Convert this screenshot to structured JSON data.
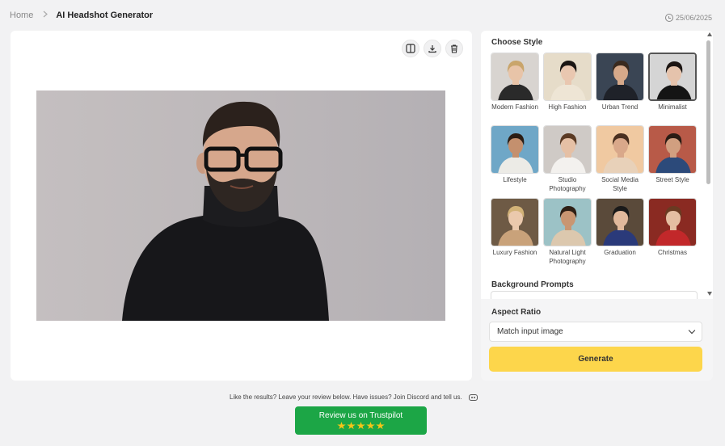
{
  "breadcrumb": {
    "home": "Home",
    "separator": ">",
    "current": "AI Headshot Generator"
  },
  "date": "25/06/2025",
  "toolbar": {
    "icons": [
      "compare-icon",
      "download-icon",
      "trash-icon"
    ]
  },
  "styles": {
    "title": "Choose Style",
    "items": [
      {
        "label": "Modern Fashion",
        "bg": "#d8d4d0",
        "hair": "#c9a56b",
        "skin": "#e8c4a8",
        "clothes": "#2a2a2a",
        "selected": false
      },
      {
        "label": "High Fashion",
        "bg": "#e6dcc9",
        "hair": "#1b1614",
        "skin": "#e9c7b0",
        "clothes": "#eee5d5",
        "selected": false
      },
      {
        "label": "Urban Trend",
        "bg": "#3a4554",
        "hair": "#3a2a1e",
        "skin": "#d6a98a",
        "clothes": "#1f2229",
        "selected": false
      },
      {
        "label": "Minimalist",
        "bg": "#d5d5d5",
        "hair": "#1c1512",
        "skin": "#e5c3ac",
        "clothes": "#141414",
        "selected": true
      },
      {
        "label": "Lifestyle",
        "bg": "#6fa7c7",
        "hair": "#2b1d14",
        "skin": "#c4906e",
        "clothes": "#ecebe6",
        "selected": false
      },
      {
        "label": "Studio Photography",
        "bg": "#cfcac6",
        "hair": "#5a3a24",
        "skin": "#e5c0a5",
        "clothes": "#f3f1ee",
        "selected": false
      },
      {
        "label": "Social Media Style",
        "bg": "#f0c9a1",
        "hair": "#4a3020",
        "skin": "#d9a88a",
        "clothes": "#e8d1b9",
        "selected": false
      },
      {
        "label": "Street Style",
        "bg": "#b85a48",
        "hair": "#2a1c14",
        "skin": "#d19f80",
        "clothes": "#2c4a7a",
        "selected": false
      },
      {
        "label": "Luxury Fashion",
        "bg": "#6e5a45",
        "hair": "#d2b277",
        "skin": "#ebc9ad",
        "clothes": "#c9a27a",
        "selected": false
      },
      {
        "label": "Natural Light Photography",
        "bg": "#9cc2c6",
        "hair": "#2e1f15",
        "skin": "#c99672",
        "clothes": "#dcc8ae",
        "selected": false
      },
      {
        "label": "Graduation",
        "bg": "#5a4a3a",
        "hair": "#1a1a1a",
        "skin": "#e1b99c",
        "clothes": "#2a3a7a",
        "selected": false
      },
      {
        "label": "Christmas",
        "bg": "#8a2a22",
        "hair": "#6a3a22",
        "skin": "#e5bea2",
        "clothes": "#c2282a",
        "selected": false
      }
    ]
  },
  "background_prompts": {
    "title": "Background Prompts"
  },
  "aspect": {
    "title": "Aspect Ratio",
    "value": "Match input image"
  },
  "generate_label": "Generate",
  "footer": {
    "text": "Like the results? Leave your review below. Have issues? Join Discord and tell us.",
    "trustpilot_label": "Review us on Trustpilot",
    "stars": 5
  }
}
